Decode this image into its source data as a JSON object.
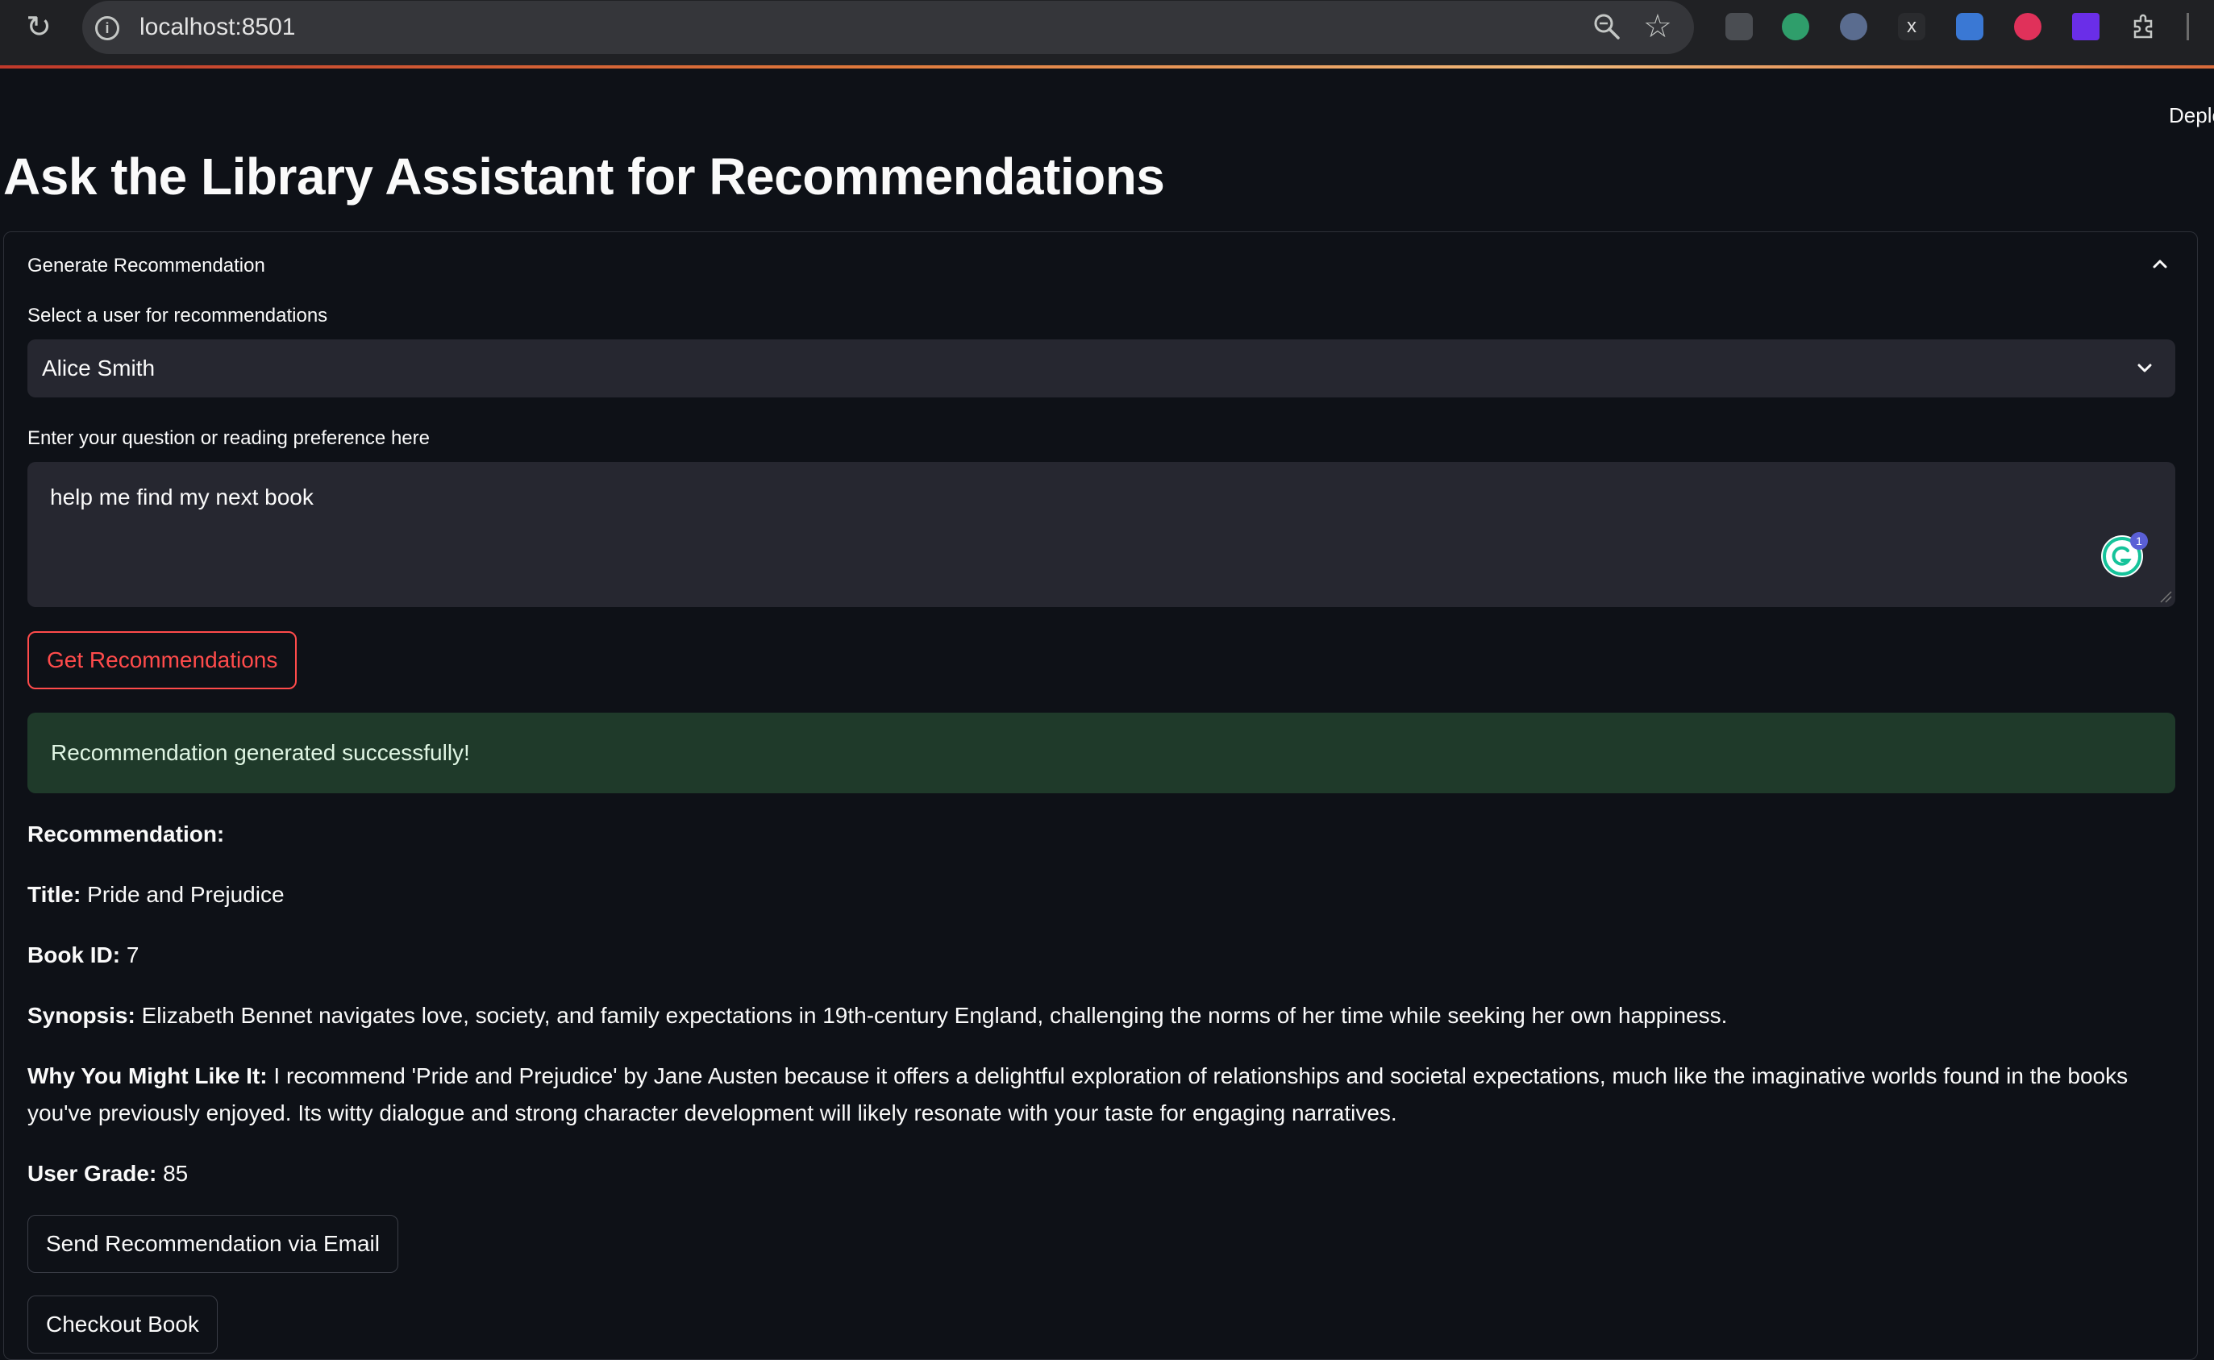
{
  "browser": {
    "url": "localhost:8501",
    "deploy_label": "Deplo"
  },
  "page": {
    "title": "Ask the Library Assistant for Recommendations"
  },
  "expander": {
    "title": "Generate Recommendation"
  },
  "form": {
    "user_select_label": "Select a user for recommendations",
    "user_selected": "Alice Smith",
    "question_label": "Enter your question or reading preference here",
    "question_value": "help me find my next book",
    "submit_label": "Get Recommendations",
    "grammarly_count": "1"
  },
  "result": {
    "success_message": "Recommendation generated successfully!",
    "heading": "Recommendation:",
    "title_label": "Title:",
    "title_value": "Pride and Prejudice",
    "book_id_label": "Book ID:",
    "book_id_value": "7",
    "synopsis_label": "Synopsis:",
    "synopsis_value": "Elizabeth Bennet navigates love, society, and family expectations in 19th-century England, challenging the norms of her time while seeking her own happiness.",
    "why_label": "Why You Might Like It:",
    "why_value": "I recommend 'Pride and Prejudice' by Jane Austen because it offers a delightful exploration of relationships and societal expectations, much like the imaginative worlds found in the books you've previously enjoyed. Its witty dialogue and strong character development will likely resonate with your taste for engaging narratives.",
    "grade_label": "User Grade:",
    "grade_value": "85"
  },
  "actions": {
    "email_label": "Send Recommendation via Email",
    "checkout_label": "Checkout Book"
  },
  "colors": {
    "background": "#0e1117",
    "accent": "#ff4b4b",
    "success_bg": "#1f3a2a",
    "input_bg": "#262730"
  },
  "icons": {
    "reload": "reload-icon",
    "info": "info-icon",
    "zoom": "zoom-icon",
    "bookmark": "star-icon",
    "extensions": "puzzle-icon",
    "collapse": "chevron-up-icon",
    "dropdown": "chevron-down-icon"
  }
}
